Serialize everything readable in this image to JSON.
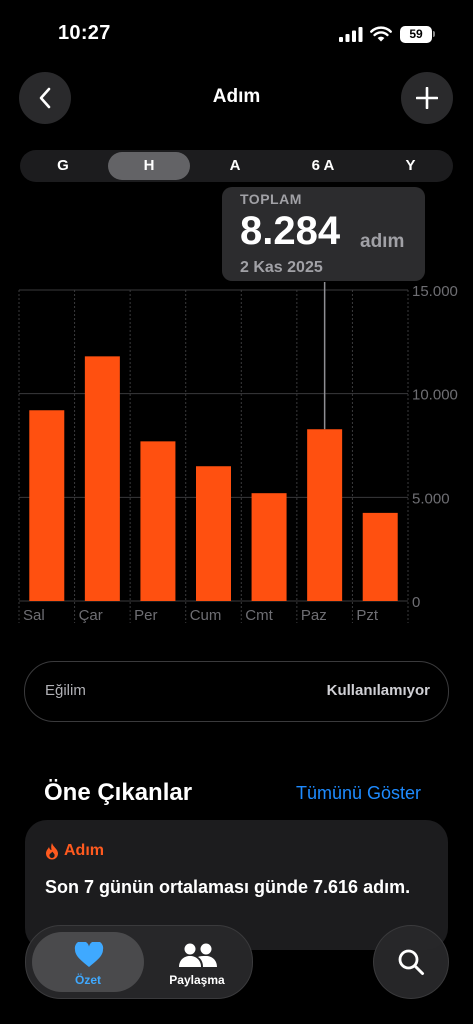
{
  "status": {
    "time": "10:27",
    "battery": "59"
  },
  "header": {
    "title": "Adım"
  },
  "segments": [
    "G",
    "H",
    "A",
    "6 A",
    "Y"
  ],
  "selected_segment": "H",
  "tooltip": {
    "label": "TOPLAM",
    "value": "8.284",
    "unit": "adım",
    "date": "2 Kas 2025"
  },
  "chart_data": {
    "type": "bar",
    "categories": [
      "Sal",
      "Çar",
      "Per",
      "Cum",
      "Cmt",
      "Paz",
      "Pzt"
    ],
    "values": [
      9200,
      11800,
      7700,
      6500,
      5200,
      8284,
      4250
    ],
    "ylim": [
      0,
      15000
    ],
    "yticks": [
      0,
      5000,
      10000,
      15000
    ],
    "ytick_labels": [
      "0",
      "5.000",
      "10.000",
      "15.000"
    ],
    "highlight_index": 5,
    "bar_color": "#ff5010",
    "grid": true
  },
  "trend": {
    "label": "Eğilim",
    "value": "Kullanılamıyor"
  },
  "highlights": {
    "title": "Öne Çıkanlar",
    "link": "Tümünü Göster",
    "card": {
      "category": "Adım",
      "text": "Son 7 günün ortalaması günde 7.616 adım."
    }
  },
  "tabbar": {
    "tabs": [
      {
        "label": "Özet"
      },
      {
        "label": "Paylaşma"
      }
    ]
  },
  "colors": {
    "accent": "#1e8bff",
    "bar": "#ff5010",
    "heart": "#3fa9ff"
  }
}
